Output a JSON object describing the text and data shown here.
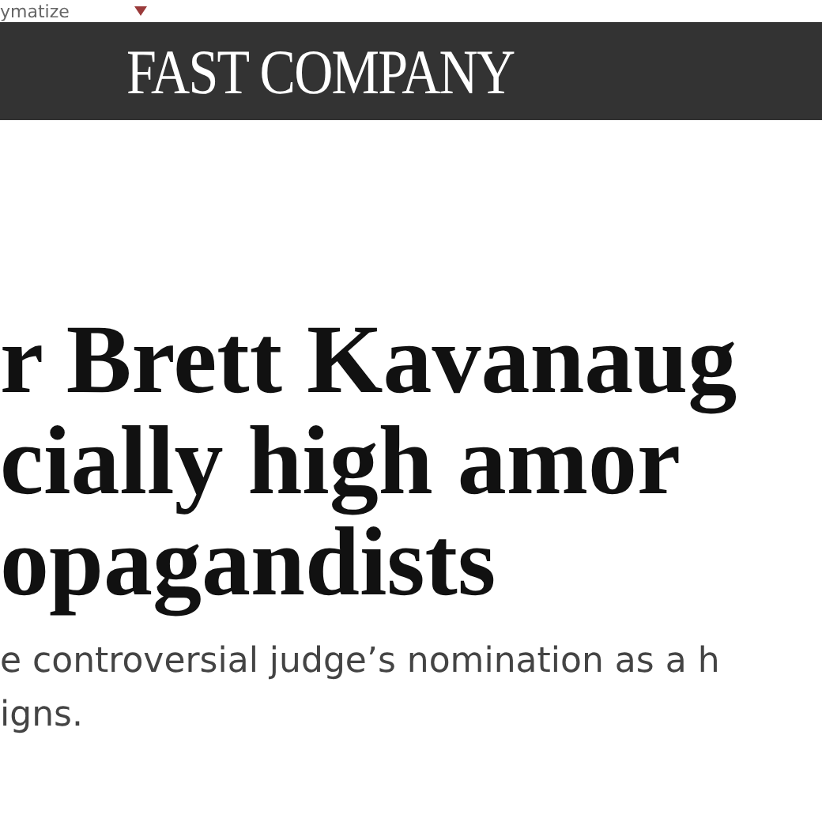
{
  "top_strip": {
    "text": "ymatize"
  },
  "header": {
    "logo": "FAST COMPANY"
  },
  "article": {
    "headline_lines": [
      "r Brett Kavanaug",
      "cially high amor",
      "opagandists"
    ],
    "dek_lines": [
      "e controversial judge’s nomination as a h",
      "igns."
    ]
  }
}
